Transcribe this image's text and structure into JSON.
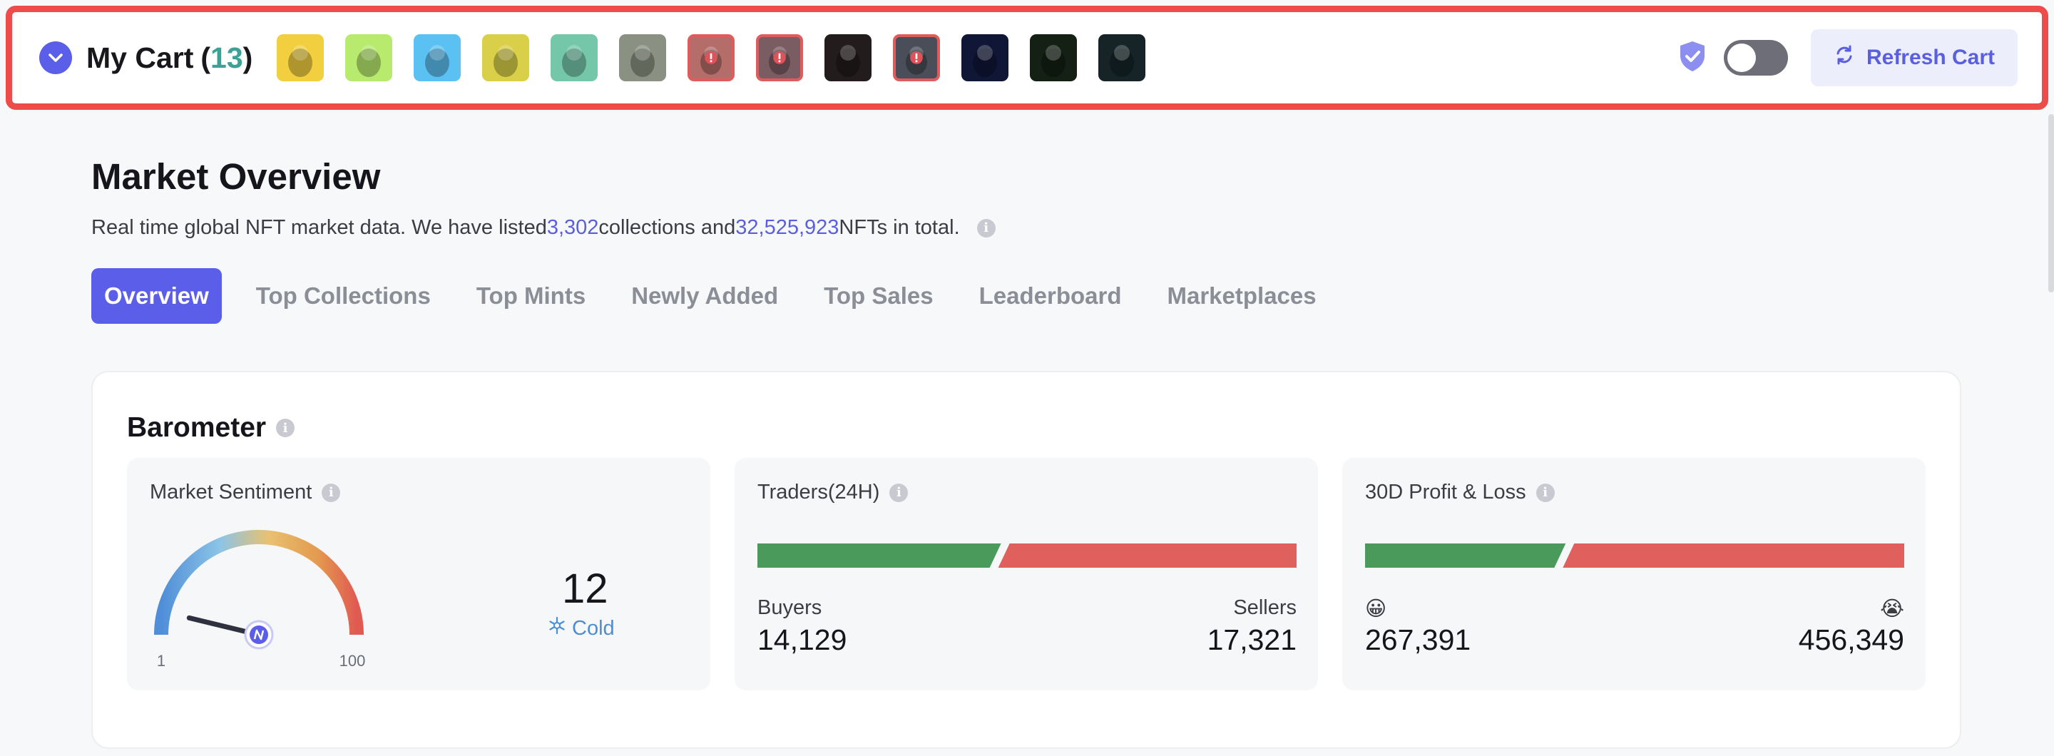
{
  "cart": {
    "title": "My Cart",
    "open_paren": "(",
    "count": "13",
    "close_paren": ")",
    "items": [
      {
        "icon": "nft-pepe-thumb",
        "bg": "#f2cf3f"
      },
      {
        "icon": "nft-hooded-green-thumb",
        "bg": "#b8ea6d"
      },
      {
        "icon": "nft-hooded-blue-thumb",
        "bg": "#5bc0f2"
      },
      {
        "icon": "nft-ape-yellow-thumb",
        "bg": "#d9cf48"
      },
      {
        "icon": "nft-ape-teal-thumb",
        "bg": "#74c7a9"
      },
      {
        "icon": "nft-ape-gray-thumb",
        "bg": "#8a9182"
      },
      {
        "icon": "nft-ape-flagged-thumb",
        "bg": "#b56d6a",
        "flagged": true
      },
      {
        "icon": "nft-ape-flagged-thumb",
        "bg": "#7a5c63",
        "flagged": true
      },
      {
        "icon": "nft-dark-thumb",
        "bg": "#231c1c"
      },
      {
        "icon": "nft-dark-flagged-thumb",
        "bg": "#4a4e58",
        "flagged": true
      },
      {
        "icon": "nft-space-thumb",
        "bg": "#101636"
      },
      {
        "icon": "nft-green-thumb",
        "bg": "#142014"
      },
      {
        "icon": "nft-cube-thumb",
        "bg": "#162428"
      }
    ],
    "refresh_label": "Refresh Cart"
  },
  "market": {
    "title": "Market Overview",
    "subtitle_prefix": "Real time global NFT market data. We have listed ",
    "collections_count": "3,302",
    "subtitle_mid": " collections and ",
    "nfts_count": "32,525,923",
    "subtitle_suffix": " NFTs in total.",
    "tabs": [
      "Overview",
      "Top Collections",
      "Top Mints",
      "Newly Added",
      "Top Sales",
      "Leaderboard",
      "Marketplaces"
    ]
  },
  "barometer": {
    "title": "Barometer",
    "sentiment": {
      "title": "Market Sentiment",
      "value": "12",
      "label": "Cold",
      "min": "1",
      "max": "100",
      "level": 12
    },
    "traders": {
      "title": "Traders(24H)",
      "left_label": "Buyers",
      "right_label": "Sellers",
      "left_value": "14,129",
      "right_value": "17,321",
      "left_number": 14129,
      "right_number": 17321
    },
    "pnl": {
      "title": "30D Profit & Loss",
      "left_label": "😀",
      "right_label": "😭",
      "left_value": "267,391",
      "right_value": "456,349",
      "left_number": 267391,
      "right_number": 456349
    }
  },
  "colors": {
    "accent": "#5b5ee8",
    "buy_green": "#4a9a5c",
    "sell_red": "#e0605d",
    "cart_border": "#ef4b4b"
  }
}
